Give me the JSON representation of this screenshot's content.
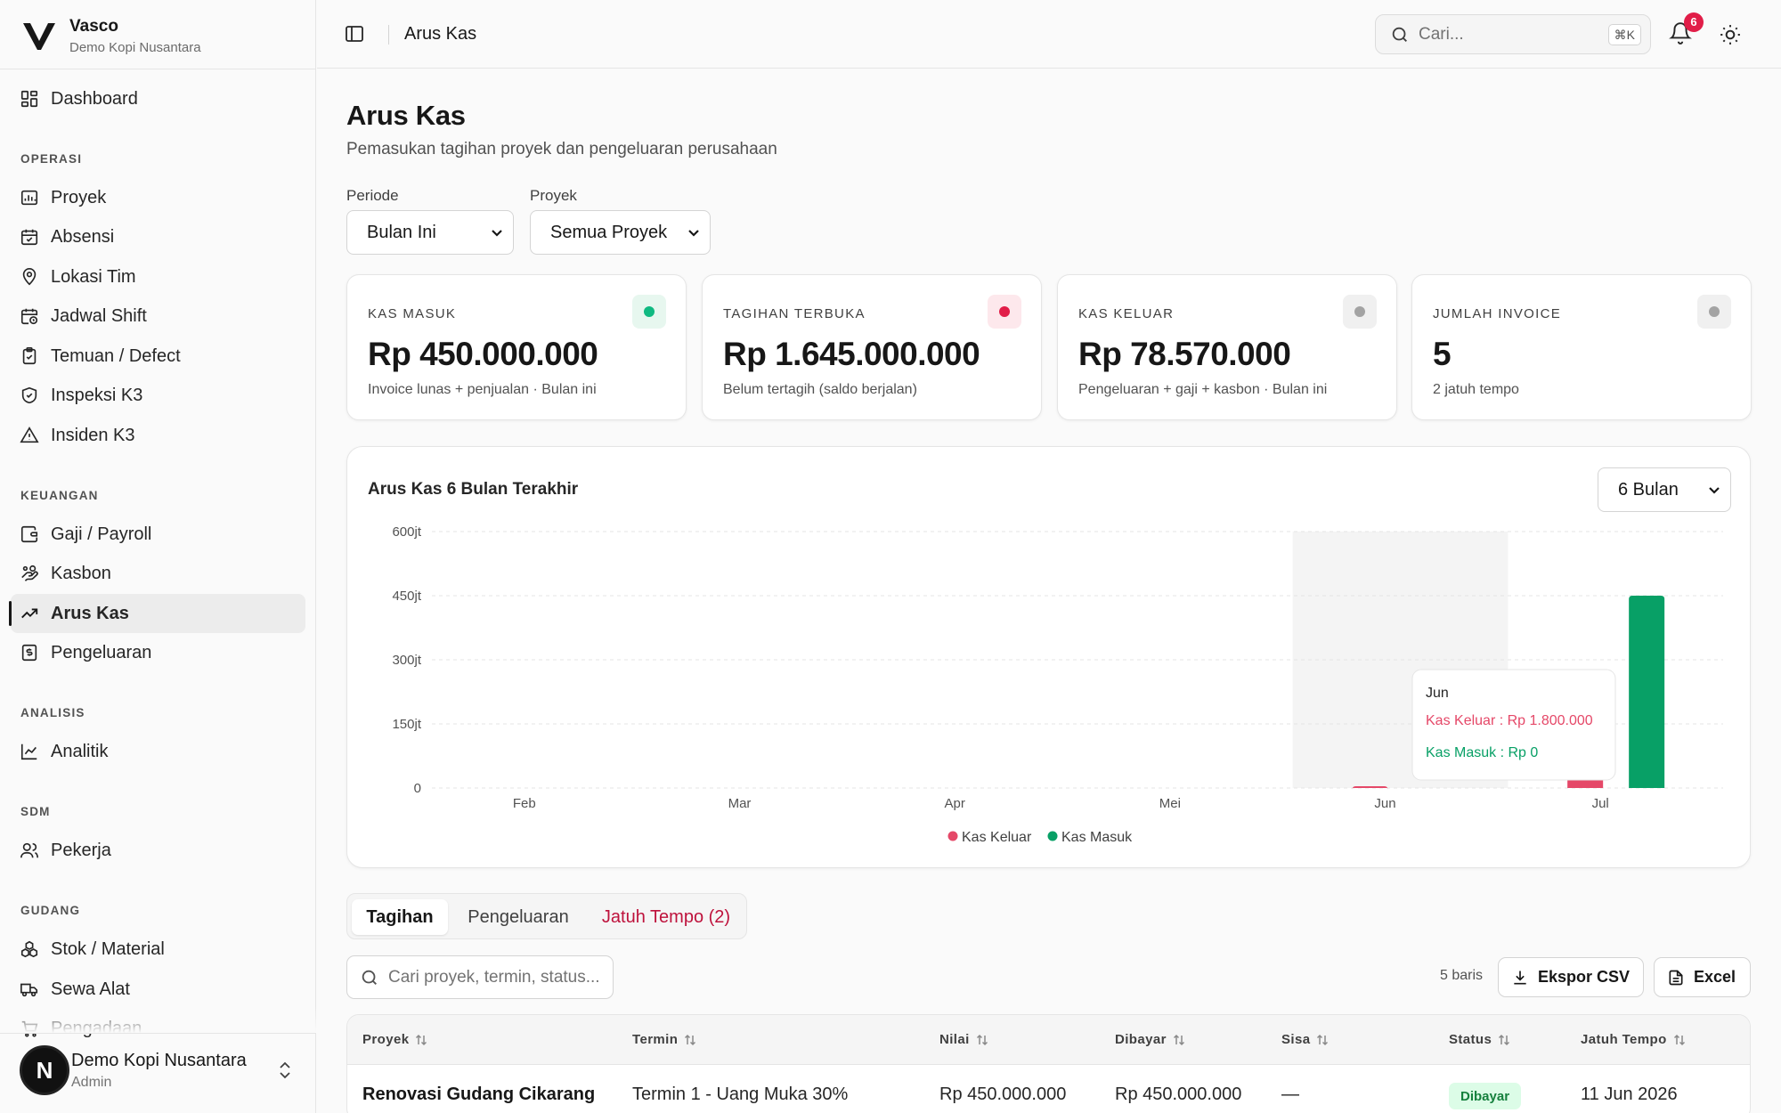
{
  "brand": {
    "name": "Vasco",
    "org": "Demo Kopi Nusantara"
  },
  "colors": {
    "kas_keluar": "#e54868",
    "kas_masuk": "#08a066",
    "accent": "#171717",
    "danger": "#e11d48"
  },
  "sidebar": {
    "dashboard": "Dashboard",
    "sections": {
      "operasi": "OPERASI",
      "keuangan": "KEUANGAN",
      "analisis": "ANALISIS",
      "sdm": "SDM",
      "gudang": "GUDANG"
    },
    "items": {
      "proyek": "Proyek",
      "absensi": "Absensi",
      "lokasi_tim": "Lokasi Tim",
      "jadwal_shift": "Jadwal Shift",
      "temuan": "Temuan / Defect",
      "inspeksi": "Inspeksi K3",
      "insiden": "Insiden K3",
      "gaji": "Gaji / Payroll",
      "kasbon": "Kasbon",
      "arus_kas": "Arus Kas",
      "pengeluaran": "Pengeluaran",
      "analitik": "Analitik",
      "pekerja": "Pekerja",
      "stok": "Stok / Material",
      "sewa_alat": "Sewa Alat",
      "pengadaan": "Pengadaan"
    },
    "user": {
      "initial": "N",
      "name": "Demo Kopi Nusantara",
      "role": "Admin"
    }
  },
  "topbar": {
    "title": "Arus Kas",
    "search_placeholder": "Cari...",
    "search_shortcut": "⌘K",
    "notification_count": "6"
  },
  "page": {
    "title": "Arus Kas",
    "subtitle": "Pemasukan tagihan proyek dan pengeluaran perusahaan"
  },
  "filters": {
    "periode_label": "Periode",
    "periode_value": "Bulan Ini",
    "proyek_label": "Proyek",
    "proyek_value": "Semua Proyek"
  },
  "stats": [
    {
      "label": "KAS MASUK",
      "value": "Rp 450.000.000",
      "sub": "Invoice lunas + penjualan · Bulan ini",
      "dot": "#10b981",
      "dot_bg": "#e7f7ef"
    },
    {
      "label": "TAGIHAN TERBUKA",
      "value": "Rp 1.645.000.000",
      "sub": "Belum tertagih (saldo berjalan)",
      "dot": "#e11d48",
      "dot_bg": "#fde8ec"
    },
    {
      "label": "KAS KELUAR",
      "value": "Rp 78.570.000",
      "sub": "Pengeluaran + gaji + kasbon · Bulan ini",
      "dot": "#a3a3a3",
      "dot_bg": "#f0f0f0"
    },
    {
      "label": "JUMLAH INVOICE",
      "value": "5",
      "sub": "2 jatuh tempo",
      "dot": "#a3a3a3",
      "dot_bg": "#f0f0f0"
    }
  ],
  "chart": {
    "title": "Arus Kas 6 Bulan Terakhir",
    "range_value": "6 Bulan",
    "tooltip": {
      "month": "Jun",
      "keluar": "Kas Keluar : Rp 1.800.000",
      "masuk": "Kas Masuk : Rp 0"
    }
  },
  "chart_data": {
    "type": "bar",
    "categories": [
      "Feb",
      "Mar",
      "Apr",
      "Mei",
      "Jun",
      "Jul"
    ],
    "series": [
      {
        "name": "Kas Keluar",
        "values": [
          0,
          0,
          0,
          0,
          1.8,
          78.57
        ],
        "color": "#e54868"
      },
      {
        "name": "Kas Masuk",
        "values": [
          0,
          0,
          0,
          0,
          0,
          450
        ],
        "color": "#08a066"
      }
    ],
    "y_unit": "jt (juta Rupiah)",
    "ylim": [
      0,
      600
    ],
    "y_ticks": [
      "0",
      "150jt",
      "300jt",
      "450jt",
      "600jt"
    ],
    "y_tick_values": [
      0,
      150,
      300,
      450,
      600
    ],
    "grid": "horizontal dashed",
    "legend": "bottom-center",
    "highlighted_category": "Jun"
  },
  "tabs": {
    "tagihan": "Tagihan",
    "pengeluaran": "Pengeluaran",
    "jatuh_tempo": "Jatuh Tempo (2)"
  },
  "table": {
    "search_placeholder": "Cari proyek, termin, status...",
    "row_count": "5 baris",
    "export_csv": "Ekspor CSV",
    "export_excel": "Excel",
    "headers": {
      "proyek": "Proyek",
      "termin": "Termin",
      "nilai": "Nilai",
      "dibayar": "Dibayar",
      "sisa": "Sisa",
      "status": "Status",
      "jatuh_tempo": "Jatuh Tempo"
    },
    "rows": [
      {
        "proyek": "Renovasi Gudang Cikarang",
        "termin": "Termin 1 - Uang Muka 30%",
        "nilai": "Rp 450.000.000",
        "dibayar": "Rp 450.000.000",
        "sisa": "—",
        "status": "Dibayar",
        "jatuh_tempo": "11 Jun 2026"
      }
    ]
  }
}
